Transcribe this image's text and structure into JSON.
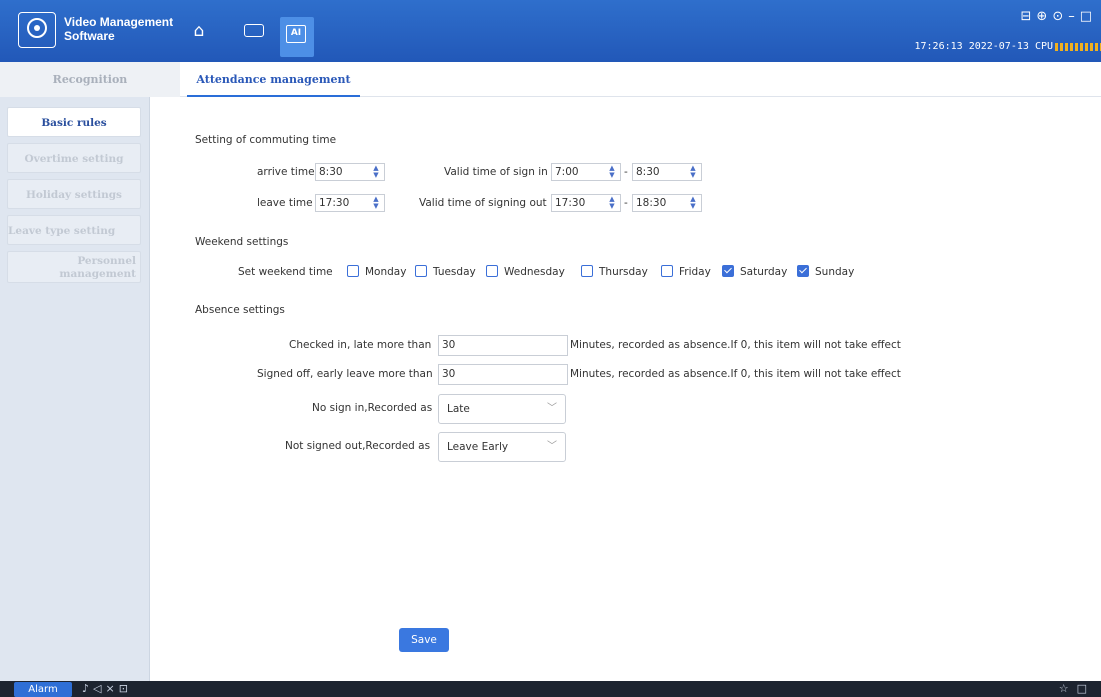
{
  "app": {
    "title": "Video Management Software"
  },
  "status": {
    "time": "17:26:13",
    "date": "2022-07-13",
    "cpu_label": "CPU"
  },
  "tabs": [
    {
      "label": "Recognition",
      "active": false
    },
    {
      "label": "Attendance management",
      "active": true
    }
  ],
  "sidebar": {
    "items": [
      {
        "label": "Basic rules",
        "active": true
      },
      {
        "label": "Overtime setting",
        "active": false
      },
      {
        "label": "Holiday settings",
        "active": false
      },
      {
        "label": "Leave type setting",
        "active": false
      },
      {
        "label": "Personnel management",
        "active": false
      }
    ]
  },
  "commuting": {
    "title": "Setting of commuting time",
    "arrive_label": "arrive time",
    "arrive_value": "8:30",
    "leave_label": "leave time",
    "leave_value": "17:30",
    "sign_in_label": "Valid time of sign in",
    "sign_in_from": "7:00",
    "sign_in_to": "8:30",
    "sign_out_label": "Valid time of signing out",
    "sign_out_from": "17:30",
    "sign_out_to": "18:30",
    "dash": "-"
  },
  "weekend": {
    "title": "Weekend settings",
    "label": "Set weekend time",
    "days": [
      {
        "label": "Monday",
        "checked": false
      },
      {
        "label": "Tuesday",
        "checked": false
      },
      {
        "label": "Wednesday",
        "checked": false
      },
      {
        "label": "Thursday",
        "checked": false
      },
      {
        "label": "Friday",
        "checked": false
      },
      {
        "label": "Saturday",
        "checked": true
      },
      {
        "label": "Sunday",
        "checked": true
      }
    ]
  },
  "absence": {
    "title": "Absence settings",
    "late_label": "Checked in, late more than",
    "late_value": "30",
    "late_hint": "Minutes, recorded as absence.If 0, this item will not take effect",
    "early_label": "Signed off, early leave more than",
    "early_value": "30",
    "early_hint": "Minutes, recorded as absence.If 0, this item will not take effect",
    "no_sign_in_label": "No sign in,Recorded as",
    "no_sign_in_value": "Late",
    "not_signed_out_label": "Not signed out,Recorded as",
    "not_signed_out_value": "Leave Early"
  },
  "save_label": "Save",
  "taskbar": {
    "alarm_label": "Alarm"
  },
  "colors": {
    "accent": "#2a6ed8",
    "titlebar": "#2258b8",
    "sidebar": "#dfe6f0"
  }
}
